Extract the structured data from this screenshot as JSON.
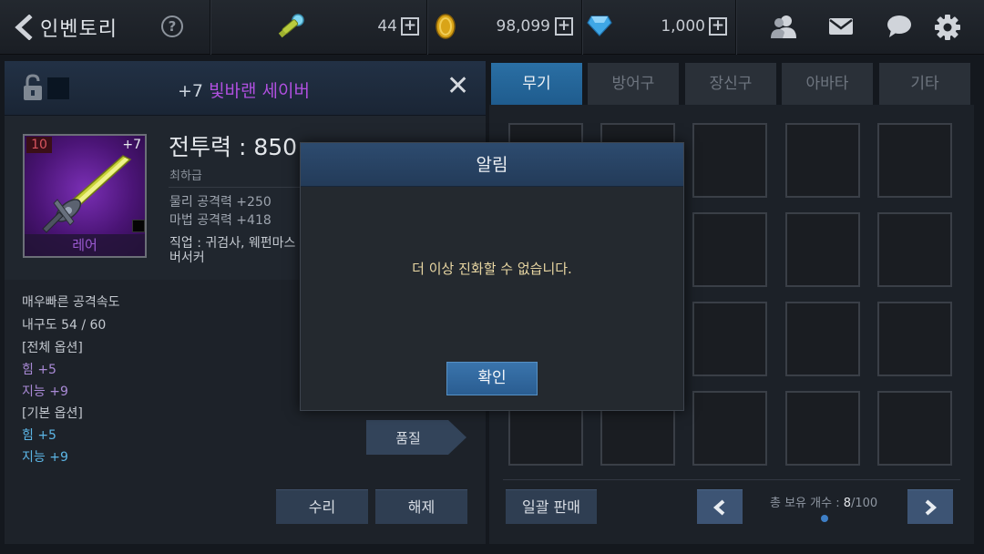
{
  "header": {
    "title": "인벤토리",
    "help_label": "?",
    "currencies": [
      {
        "icon": "key-icon",
        "value": "44",
        "plus": "+"
      },
      {
        "icon": "gold-coin-icon",
        "value": "98,099",
        "plus": "+"
      },
      {
        "icon": "gem-icon",
        "value": "1,000",
        "plus": "+"
      }
    ],
    "icons": [
      "friends-icon",
      "mail-icon",
      "chat-icon",
      "settings-icon"
    ]
  },
  "item_detail": {
    "enhance_prefix": "+7",
    "name": "빛바랜 세이버",
    "name_color": "#b050e0",
    "level": "10",
    "enhance_badge": "+7",
    "rarity": "레어",
    "combat_power": "전투력 : 850",
    "grade": "최하급",
    "stats": [
      "물리 공격력 +250",
      "마법 공격력 +418"
    ],
    "job_line1": "직업 : 귀검사, 웨펀마스",
    "job_line2": "버서커",
    "options": [
      {
        "text": "매우빠른 공격속도",
        "style": "white"
      },
      {
        "text": "내구도 54 / 60",
        "style": "white"
      },
      {
        "text": "[전체 옵션]",
        "style": "white"
      },
      {
        "text": "힘 +5",
        "style": "purple"
      },
      {
        "text": "지능 +9",
        "style": "purple"
      },
      {
        "text": "[기본 옵션]",
        "style": "white"
      },
      {
        "text": "힘 +5",
        "style": "blue"
      },
      {
        "text": "지능 +9",
        "style": "blue"
      }
    ],
    "quality_button": "품질",
    "repair_button": "수리",
    "unequip_button": "해제"
  },
  "inventory": {
    "tabs": [
      "무기",
      "방어구",
      "장신구",
      "아바타",
      "기타"
    ],
    "active_tab": 0,
    "sell_all_button": "일괄 판매",
    "count_label": "총 보유 개수 :",
    "count_current": "8",
    "count_max": "/100"
  },
  "modal": {
    "title": "알림",
    "message": "더 이상 진화할 수 없습니다.",
    "ok_button": "확인"
  }
}
